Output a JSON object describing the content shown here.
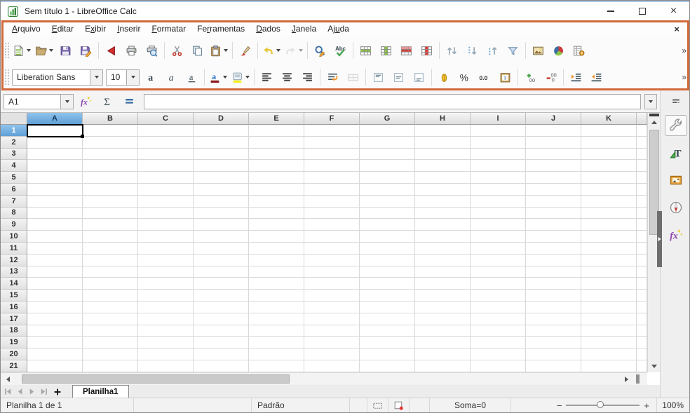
{
  "window": {
    "title": "Sem título 1 - LibreOffice Calc"
  },
  "menu": {
    "close_label": "×",
    "items": [
      {
        "label": "Arquivo",
        "accel": 0
      },
      {
        "label": "Editar",
        "accel": 0
      },
      {
        "label": "Exibir",
        "accel": 1
      },
      {
        "label": "Inserir",
        "accel": 0
      },
      {
        "label": "Formatar",
        "accel": 0
      },
      {
        "label": "Ferramentas",
        "accel": 2
      },
      {
        "label": "Dados",
        "accel": 0
      },
      {
        "label": "Janela",
        "accel": 0
      },
      {
        "label": "Ajuda",
        "accel": 2
      }
    ]
  },
  "toolbar_standard": {
    "overflow": "»",
    "buttons": [
      {
        "icon": "new-document-icon",
        "dd": true
      },
      {
        "icon": "open-icon",
        "dd": true
      },
      {
        "icon": "save-icon"
      },
      {
        "icon": "save-as-icon"
      },
      {
        "sep": true
      },
      {
        "icon": "export-pdf-icon"
      },
      {
        "icon": "print-icon"
      },
      {
        "icon": "print-preview-icon"
      },
      {
        "sep": true
      },
      {
        "icon": "cut-icon"
      },
      {
        "icon": "copy-icon"
      },
      {
        "icon": "paste-icon",
        "dd": true
      },
      {
        "sep": true
      },
      {
        "icon": "clone-formatting-icon"
      },
      {
        "sep": true
      },
      {
        "icon": "undo-icon",
        "dd": true
      },
      {
        "icon": "redo-icon",
        "dd": true,
        "disabled": true
      },
      {
        "sep": true
      },
      {
        "icon": "find-replace-icon"
      },
      {
        "icon": "spelling-icon"
      },
      {
        "sep": true
      },
      {
        "icon": "insert-rows-icon"
      },
      {
        "icon": "insert-columns-icon"
      },
      {
        "icon": "delete-rows-icon"
      },
      {
        "icon": "delete-columns-icon"
      },
      {
        "sep": true
      },
      {
        "icon": "sort-icon"
      },
      {
        "icon": "sort-ascending-icon"
      },
      {
        "icon": "sort-descending-icon"
      },
      {
        "icon": "autofilter-icon"
      },
      {
        "sep": true
      },
      {
        "icon": "insert-image-icon"
      },
      {
        "icon": "insert-chart-icon"
      },
      {
        "icon": "pivot-table-icon"
      }
    ]
  },
  "toolbar_formatting": {
    "font_name": "Liberation Sans",
    "font_size": "10",
    "overflow": "»",
    "buttons": [
      {
        "icon": "bold-icon"
      },
      {
        "icon": "italic-icon"
      },
      {
        "icon": "underline-icon"
      },
      {
        "sep": true
      },
      {
        "icon": "font-color-icon",
        "dd": true
      },
      {
        "icon": "highlight-color-icon",
        "dd": true
      },
      {
        "sep": true
      },
      {
        "icon": "align-left-icon"
      },
      {
        "icon": "align-center-icon"
      },
      {
        "icon": "align-right-icon"
      },
      {
        "sep": true
      },
      {
        "icon": "wrap-text-icon"
      },
      {
        "icon": "merge-cells-icon",
        "disabled": true
      },
      {
        "sep": true
      },
      {
        "icon": "align-top-icon"
      },
      {
        "icon": "align-vcenter-icon"
      },
      {
        "icon": "align-bottom-icon"
      },
      {
        "sep": true
      },
      {
        "icon": "currency-format-icon"
      },
      {
        "icon": "percent-format-icon"
      },
      {
        "icon": "number-format-icon"
      },
      {
        "icon": "date-format-icon"
      },
      {
        "sep": true
      },
      {
        "icon": "add-decimal-icon"
      },
      {
        "icon": "delete-decimal-icon"
      },
      {
        "sep": true
      },
      {
        "icon": "increase-indent-icon"
      },
      {
        "icon": "decrease-indent-icon"
      }
    ]
  },
  "formula_bar": {
    "cell_reference": "A1",
    "input_value": "",
    "tools": [
      "function-wizard-icon",
      "sum-icon",
      "equals-icon"
    ]
  },
  "grid": {
    "columns": [
      "A",
      "B",
      "C",
      "D",
      "E",
      "F",
      "G",
      "H",
      "I",
      "J",
      "K"
    ],
    "rows": [
      "1",
      "2",
      "3",
      "4",
      "5",
      "6",
      "7",
      "8",
      "9",
      "10",
      "11",
      "12",
      "13",
      "14",
      "15",
      "16",
      "17",
      "18",
      "19",
      "20",
      "21"
    ],
    "selected": {
      "column": "A",
      "row": "1"
    }
  },
  "sheet_area": {
    "nav": [
      "tab-first-icon",
      "tab-previous-icon",
      "tab-next-icon",
      "tab-last-icon"
    ],
    "tabs": [
      {
        "label": "Planilha1",
        "active": true
      }
    ]
  },
  "status_bar": {
    "sheet_position": "Planilha 1 de 1",
    "page_style": "Padrão",
    "sum": "Soma=0",
    "zoom_level": "100%"
  },
  "sidebar": {
    "items": [
      {
        "icon": "sidebar-settings-icon",
        "small": true
      },
      {
        "icon": "properties-icon",
        "active": true
      },
      {
        "icon": "styles-icon"
      },
      {
        "icon": "gallery-icon"
      },
      {
        "icon": "navigator-icon"
      },
      {
        "icon": "functions-icon"
      }
    ]
  },
  "colors": {
    "annotation_orange": "#d2693a",
    "selection_blue": "#5f9fd6"
  }
}
